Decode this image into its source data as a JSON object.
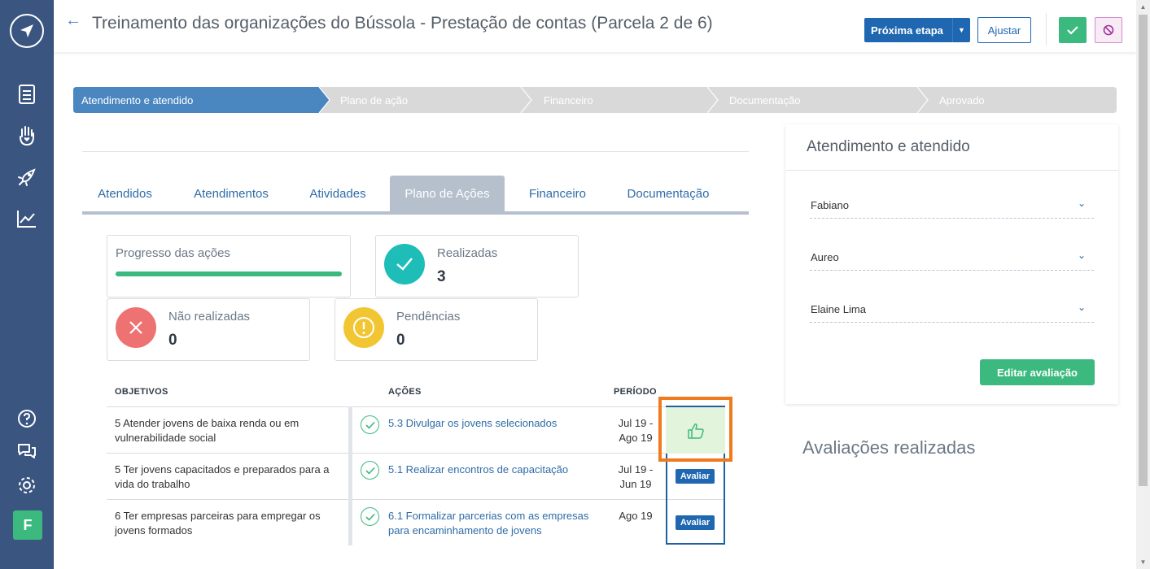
{
  "header": {
    "title": "Treinamento das organizações do Bússola - Prestação de contas (Parcela 2 de 6)",
    "next_step_label": "Próxima etapa",
    "adjust_label": "Ajustar"
  },
  "sidebar": {
    "avatar_initial": "F",
    "icons": [
      "logo-icon",
      "document-icon",
      "hand-heart-icon",
      "rocket-icon",
      "chart-icon",
      "help-icon",
      "chat-icon",
      "gear-icon"
    ]
  },
  "stepper": {
    "steps": [
      {
        "label": "Atendimento e atendido",
        "active": true
      },
      {
        "label": "Plano de ação",
        "active": false
      },
      {
        "label": "Financeiro",
        "active": false
      },
      {
        "label": "Documentação",
        "active": false
      },
      {
        "label": "Aprovado",
        "active": false
      }
    ]
  },
  "tabs": [
    {
      "label": "Atendidos"
    },
    {
      "label": "Atendimentos"
    },
    {
      "label": "Atividades"
    },
    {
      "label": "Plano de Ações",
      "active": true
    },
    {
      "label": "Financeiro"
    },
    {
      "label": "Documentação"
    }
  ],
  "stats": {
    "progress": {
      "label": "Progresso das ações",
      "value": 1.0
    },
    "done": {
      "label": "Realizadas",
      "value": "3"
    },
    "not_done": {
      "label": "Não realizadas",
      "value": "0"
    },
    "pending": {
      "label": "Pendências",
      "value": "0"
    }
  },
  "table": {
    "headers": {
      "objectives": "OBJETIVOS",
      "actions": "AÇÕES",
      "period": "PERÍODO"
    },
    "rows": [
      {
        "objective_1": "5 Atender jovens de baixa renda ou em",
        "objective_2": "vulnerabilidade social",
        "action_1": "5.3 Divulgar os jovens selecionados",
        "action_2": "",
        "period_1": "Jul 19 -",
        "period_2": "Ago 19",
        "evaluated": true
      },
      {
        "objective_1": "5 Ter jovens capacitados e preparados para a",
        "objective_2": "vida do trabalho",
        "action_1": "5.1 Realizar encontros de capacitação",
        "action_2": "",
        "period_1": "Jul 19 -",
        "period_2": "Jun 19",
        "evaluated": false
      },
      {
        "objective_1": "6 Ter empresas parceiras para empregar os",
        "objective_2": "jovens formados",
        "action_1": "6.1 Formalizar parcerias com as empresas",
        "action_2": "para encaminhamento de jovens",
        "period_1": "Ago 19",
        "period_2": "",
        "evaluated": false
      }
    ],
    "evaluate_label": "Avaliar"
  },
  "right_panel": {
    "title": "Atendimento e atendido",
    "selects": [
      "Fabiano",
      "Aureo",
      "Elaine Lima"
    ],
    "edit_label": "Editar avaliação"
  },
  "evaluations_title": "Avaliações realizadas",
  "colors": {
    "sidebar": "#3a5580",
    "primary": "#1f67b0",
    "success": "#3cb97e",
    "step_active": "#4a86c0",
    "step_inactive": "#d9d9d9",
    "danger": "#ee7272",
    "warning": "#f2c633",
    "teal": "#1fbdb8",
    "highlight": "#f07b1e"
  }
}
